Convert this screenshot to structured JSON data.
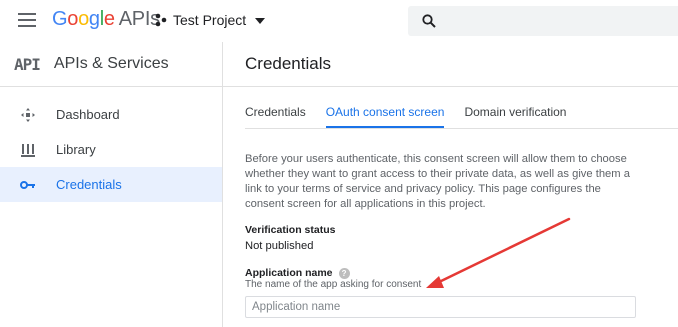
{
  "topbar": {
    "logo_google": "Google",
    "logo_apis": "APIs",
    "project_name": "Test Project"
  },
  "sidebar": {
    "badge": "API",
    "title": "APIs & Services",
    "items": [
      {
        "label": "Dashboard",
        "icon": "dashboard-icon",
        "active": false
      },
      {
        "label": "Library",
        "icon": "library-icon",
        "active": false
      },
      {
        "label": "Credentials",
        "icon": "key-icon",
        "active": true
      }
    ]
  },
  "main": {
    "title": "Credentials",
    "tabs": [
      {
        "label": "Credentials",
        "active": false
      },
      {
        "label": "OAuth consent screen",
        "active": true
      },
      {
        "label": "Domain verification",
        "active": false
      }
    ],
    "description": "Before your users authenticate, this consent screen will allow them to choose whether they want to grant access to their private data, as well as give them a link to your terms of service and privacy policy. This page configures the consent screen for all applications in this project.",
    "verification_label": "Verification status",
    "verification_value": "Not published",
    "app_name_label": "Application name",
    "app_name_help": "The name of the app asking for consent",
    "app_name_placeholder": "Application name",
    "app_name_value": ""
  },
  "colors": {
    "accent": "#1a73e8",
    "active_bg": "#e8f0fe",
    "annotation_arrow": "#e53935"
  }
}
